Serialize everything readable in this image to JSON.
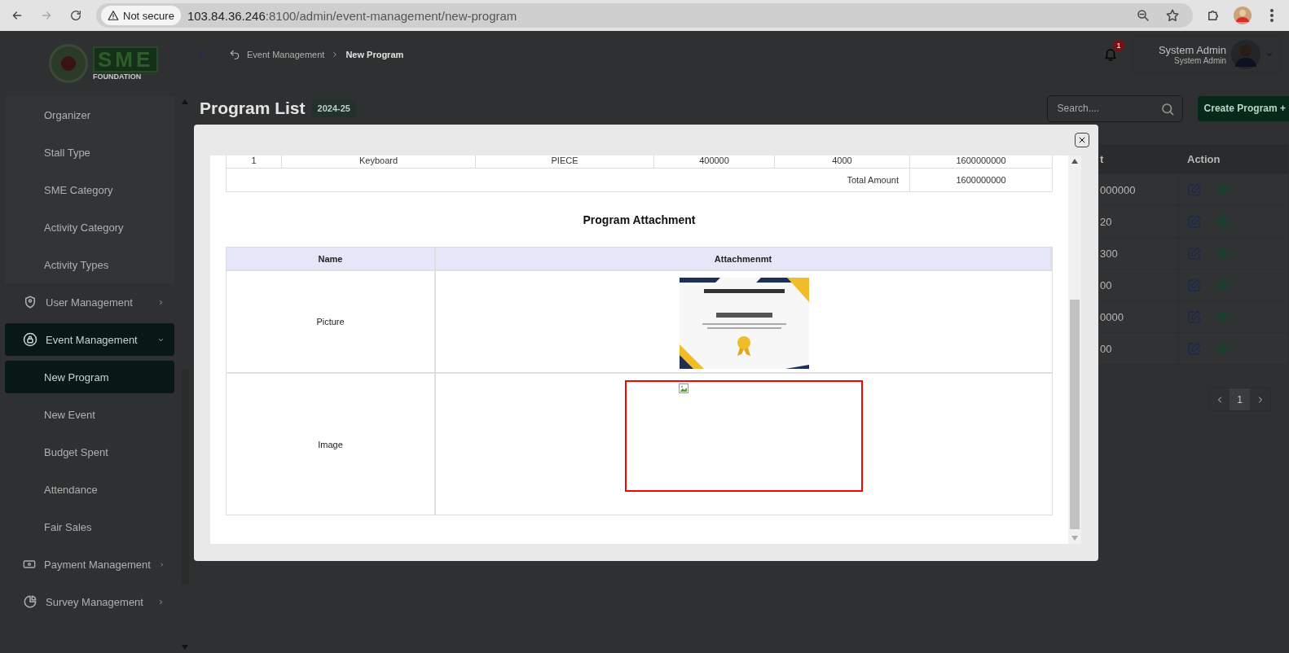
{
  "browser": {
    "security": "Not secure",
    "url_host": "103.84.36.246",
    "url_rest": ":8100/admin/event-management/new-program"
  },
  "logo": {
    "text": "SME",
    "subtitle": "FOUNDATION"
  },
  "sidebar": {
    "items": [
      {
        "label": "Organizer",
        "kind": "sub",
        "selected": false
      },
      {
        "label": "Stall Type",
        "kind": "sub",
        "selected": false
      },
      {
        "label": "SME Category",
        "kind": "sub",
        "selected": false
      },
      {
        "label": "Activity Category",
        "kind": "sub",
        "selected": false
      },
      {
        "label": "Activity Types",
        "kind": "sub",
        "selected": false
      },
      {
        "label": "User Management",
        "kind": "group",
        "selected": false,
        "expanded": false
      },
      {
        "label": "Event Management",
        "kind": "group",
        "selected": true,
        "expanded": true
      },
      {
        "label": "New Program",
        "kind": "sub",
        "selected": true
      },
      {
        "label": "New Event",
        "kind": "sub",
        "selected": false
      },
      {
        "label": "Budget Spent",
        "kind": "sub",
        "selected": false
      },
      {
        "label": "Attendance",
        "kind": "sub",
        "selected": false
      },
      {
        "label": "Fair Sales",
        "kind": "sub",
        "selected": false
      },
      {
        "label": "Payment Management",
        "kind": "group",
        "selected": false,
        "expanded": false
      },
      {
        "label": "Survey Management",
        "kind": "group",
        "selected": false,
        "expanded": false
      }
    ]
  },
  "header": {
    "breadcrumb": [
      {
        "label": "Event Management"
      },
      {
        "label": "New Program"
      }
    ],
    "notifications": "1",
    "user_name": "System Admin",
    "user_role": "System Admin"
  },
  "page": {
    "title": "Program List",
    "fiscal_year": "2024-25",
    "search_placeholder": "Search....",
    "create_button": "Create Program +",
    "table": {
      "columns": [
        "t",
        "Action"
      ],
      "rows": [
        "000000",
        "20",
        "300",
        "00",
        "0000",
        "00"
      ]
    },
    "pagination": {
      "current": "1"
    }
  },
  "modal": {
    "items_row": [
      "1",
      "Keyboard",
      "PIECE",
      "400000",
      "4000",
      "1600000000"
    ],
    "total_label": "Total Amount",
    "total_value": "1600000000",
    "attachment_title": "Program Attachment",
    "columns": [
      "Name",
      "Attachmenmt"
    ],
    "rows": [
      {
        "name": "Picture",
        "kind": "image"
      },
      {
        "name": "Image",
        "kind": "broken"
      }
    ]
  }
}
